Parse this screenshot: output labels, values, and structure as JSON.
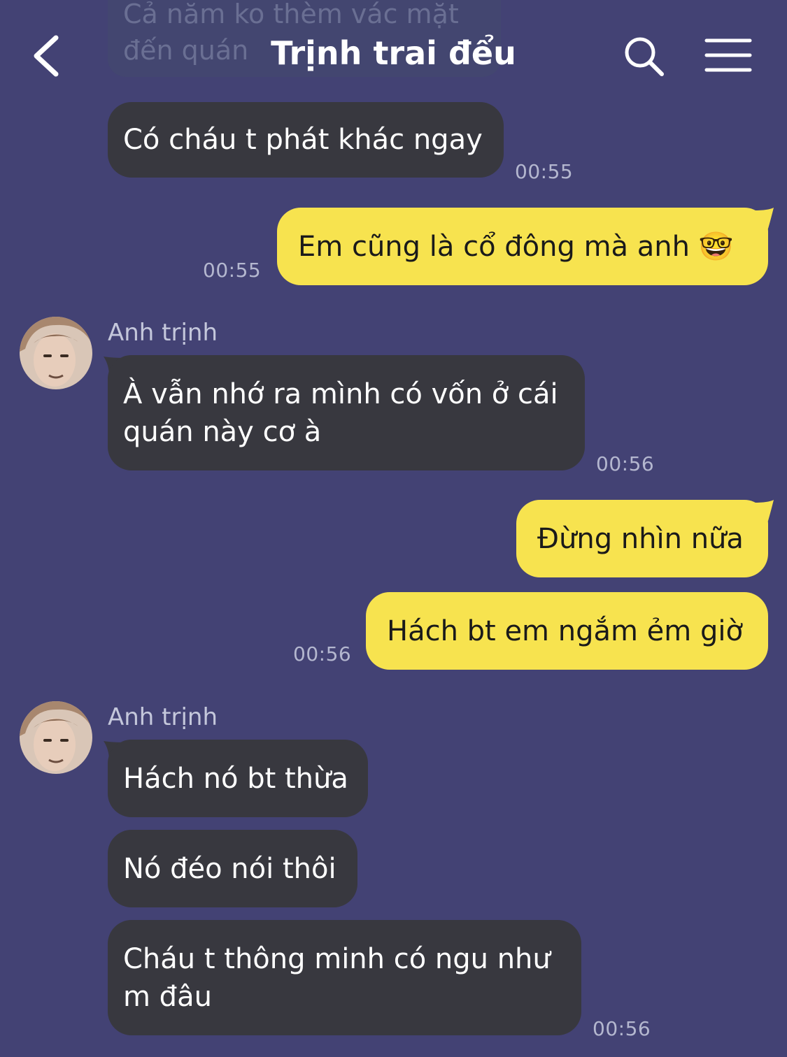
{
  "header": {
    "title": "Trịnh trai đểu",
    "back_icon": "chevron-left-icon",
    "search_icon": "search-icon",
    "menu_icon": "hamburger-menu-icon"
  },
  "messages": {
    "ghost": "Cả năm ko thèm vác mặt\nđến quán",
    "m1": {
      "text": "Có cháu t phát khác ngay",
      "time": "00:55"
    },
    "m2": {
      "text": "Em cũng là cổ đông mà anh 🤓",
      "time": "00:55"
    },
    "g1": {
      "sender": "Anh trịnh",
      "text": "À vẫn nhớ ra mình có vốn ở cái quán này cơ à",
      "time": "00:56"
    },
    "m3": {
      "text": "Đừng nhìn nữa"
    },
    "m4": {
      "text": "Hách bt em ngắm ẻm giờ",
      "time": "00:56"
    },
    "g2": {
      "sender": "Anh trịnh",
      "t1": "Hách nó bt thừa",
      "t2": "Nó đéo nói thôi",
      "t3": "Cháu t thông minh có ngu như m đâu",
      "time": "00:56"
    }
  },
  "colors": {
    "background": "#434274",
    "incoming_bubble": "#38383f",
    "outgoing_bubble": "#f7e34f"
  }
}
